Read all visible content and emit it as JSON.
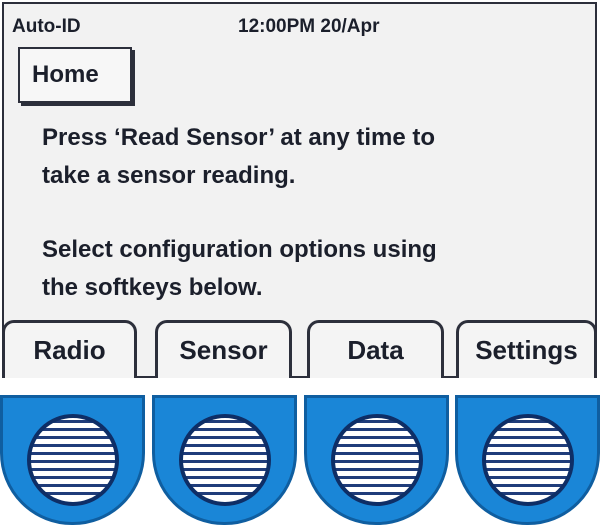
{
  "status_bar": {
    "mode": "Auto-ID",
    "time_date": "12:00PM 20/Apr"
  },
  "screen": {
    "tab_title": "Home",
    "message_1_line_1": "Press ‘Read Sensor’ at any time to",
    "message_1_line_2": "take a sensor reading.",
    "message_2_line_1": "Select configuration options using",
    "message_2_line_2": "the softkeys below."
  },
  "softkeys": [
    "Radio",
    "Sensor",
    "Data",
    "Settings"
  ],
  "colors": {
    "lcd_background": "#f2f2f2",
    "frame": "#2c2f3b",
    "button_blue": "#1a86d7"
  },
  "icons": {
    "keypad_button": "striped-circle-icon"
  }
}
